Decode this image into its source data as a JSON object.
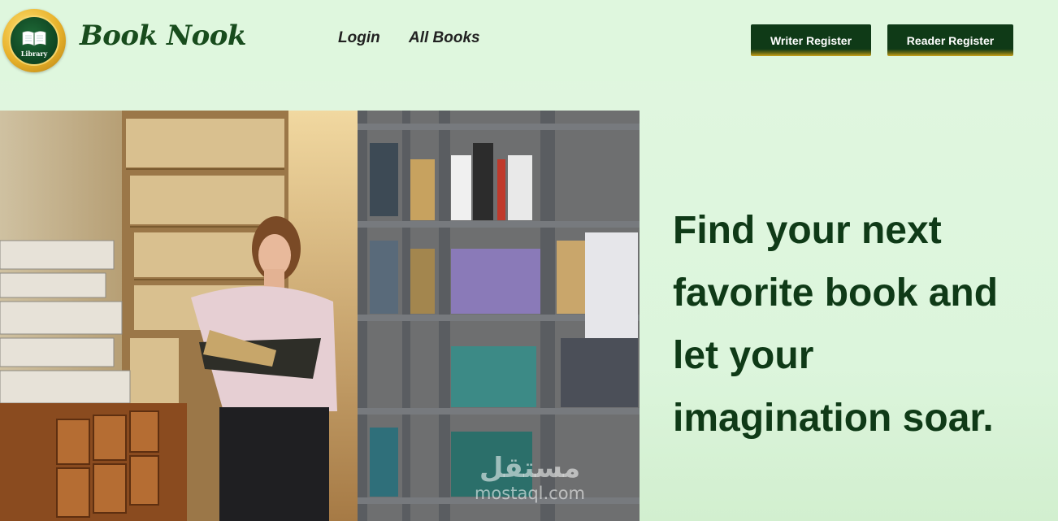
{
  "header": {
    "logo": {
      "badge_text": "Library",
      "icon": "book-logo-icon"
    },
    "brand_name": "Book Nook",
    "nav": [
      {
        "label": "Login"
      },
      {
        "label": "All Books"
      }
    ],
    "buttons": {
      "writer_register": "Writer Register",
      "reader_register": "Reader Register"
    }
  },
  "hero": {
    "image_description_icon": "library-photo",
    "title": "Find your next favorite book and let your imagination soar."
  },
  "watermark": {
    "arabic": "مستقل",
    "latin": "mostaql.com"
  },
  "colors": {
    "brand_green": "#0f3a17",
    "background": "#dff7de",
    "gold_accent": "#c9a21b"
  }
}
